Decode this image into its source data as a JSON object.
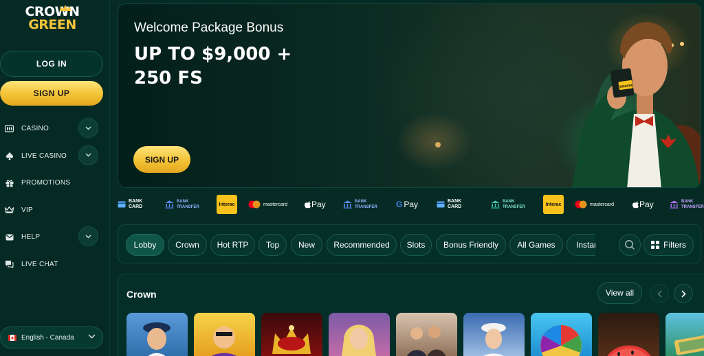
{
  "brand": {
    "line1": "CROWN",
    "line2": "GREEN"
  },
  "auth": {
    "login_label": "LOG IN",
    "signup_label": "SIGN UP"
  },
  "nav": {
    "items": [
      {
        "label": "CASINO",
        "icon": "casino-icon",
        "expandable": true
      },
      {
        "label": "LIVE CASINO",
        "icon": "spade-icon",
        "expandable": true
      },
      {
        "label": "PROMOTIONS",
        "icon": "gift-icon",
        "expandable": false
      },
      {
        "label": "VIP",
        "icon": "crown-icon",
        "expandable": false
      },
      {
        "label": "HELP",
        "icon": "mail-icon",
        "expandable": true
      },
      {
        "label": "LIVE CHAT",
        "icon": "chat-icon",
        "expandable": false
      }
    ]
  },
  "language": {
    "label": "English - Canada",
    "flag": "canada-flag-icon"
  },
  "hero": {
    "subtitle": "Welcome Package Bonus",
    "title": "UP TO $9,000 + 250 FS",
    "cta": "SIGN UP",
    "card_text": "Interac"
  },
  "payments": {
    "bank_card": [
      "BANK",
      "CARD"
    ],
    "bank_transfer": [
      "BANK",
      "TRANSFER"
    ],
    "interac": "Interac",
    "mastercard": "mastercard",
    "apple_pay": "Pay",
    "google_pay": "Pay"
  },
  "categories": {
    "items": [
      "Lobby",
      "Crown",
      "Hot RTP",
      "Top",
      "New",
      "Recommended",
      "Slots",
      "Bonus Friendly",
      "All Games",
      "Instant"
    ],
    "active": "Lobby",
    "filters_label": "Filters"
  },
  "section": {
    "title": "Crown",
    "view_all": "View all"
  },
  "colors": {
    "background": "#062b25",
    "accent_gold": "#f3c235",
    "panel": "#042f28",
    "border": "#1b5a4e"
  }
}
